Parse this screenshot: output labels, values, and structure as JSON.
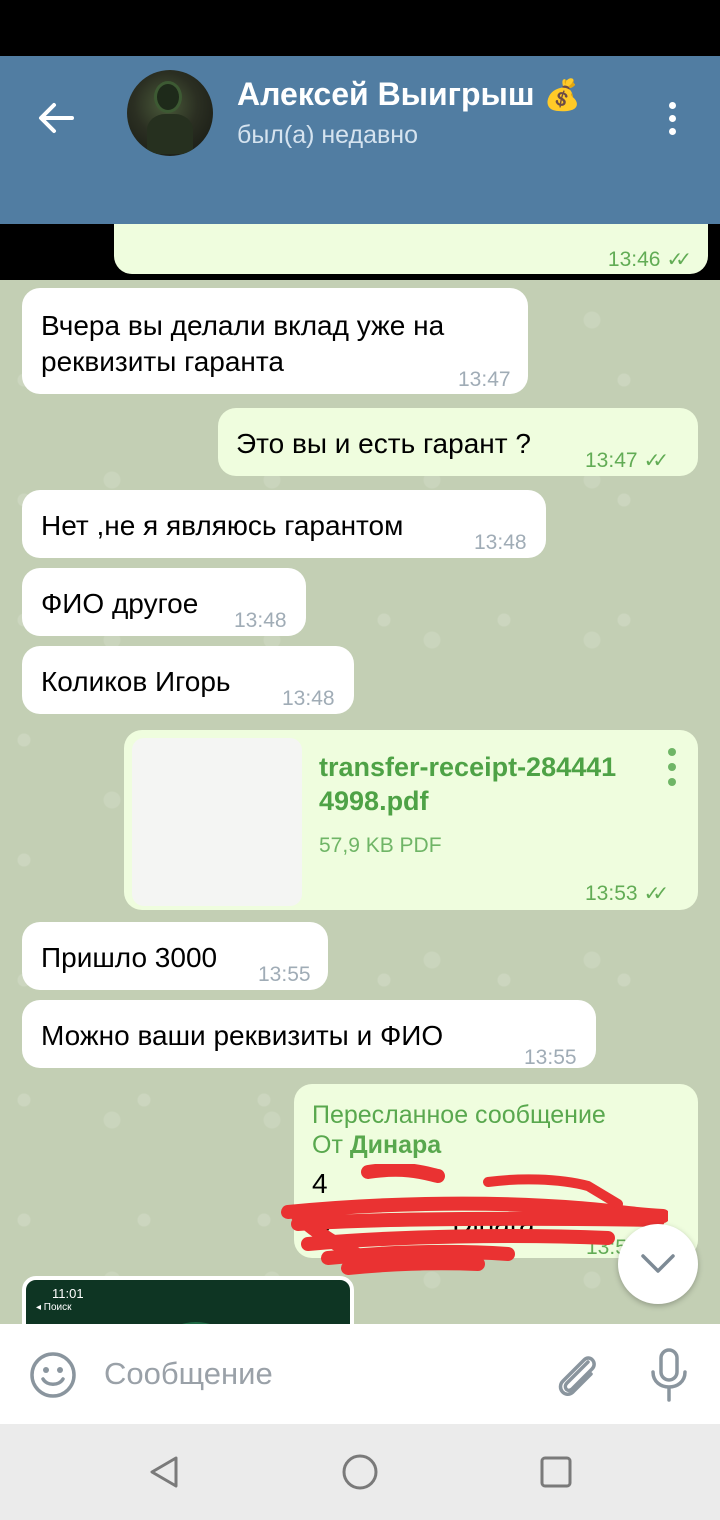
{
  "header": {
    "title": "Алексей Выигрыш",
    "title_emoji": "💰",
    "status": "был(а) недавно",
    "back_icon": "arrow-left-icon",
    "menu_icon": "more-vertical-icon"
  },
  "colors": {
    "header": "#517da2",
    "incoming_bubble": "#ffffff",
    "outgoing_bubble": "#effdde",
    "accent_green": "#4ea246"
  },
  "messages": [
    {
      "dir": "out",
      "text": "",
      "time": "13:46",
      "read": true
    },
    {
      "dir": "in",
      "text": "Вчера вы делали вклад уже на реквизиты гаранта",
      "time": "13:47"
    },
    {
      "dir": "out",
      "text": "Это вы и есть гарант ?",
      "time": "13:47",
      "read": true
    },
    {
      "dir": "in",
      "text": "Нет ,не я являюсь гарантом",
      "time": "13:48"
    },
    {
      "dir": "in",
      "text": "ФИО другое",
      "time": "13:48"
    },
    {
      "dir": "in",
      "text": "Коликов Игорь",
      "time": "13:48"
    },
    {
      "dir": "out",
      "type": "file",
      "file_name": "transfer-receipt-2844414998.pdf",
      "file_name_line1": "transfer-receipt-284441",
      "file_name_line2": "4998.pdf",
      "file_size": "57,9 KB PDF",
      "time": "13:53",
      "read": true
    },
    {
      "dir": "in",
      "text": "Пришло 3000",
      "time": "13:55"
    },
    {
      "dir": "in",
      "text": "Можно ваши реквизиты и ФИО",
      "time": "13:55"
    },
    {
      "dir": "out",
      "type": "forward",
      "forward_label": "Пересланное сообщение",
      "from_prefix": "От ",
      "from_name": "Динара",
      "line1": "4",
      "line2": "D",
      "line2_end": "Dinara",
      "time": "13:5"
    }
  ],
  "preview": {
    "time": "11:01",
    "back": "◂ Поиск"
  },
  "input": {
    "placeholder": "Сообщение",
    "emoji_icon": "smile-icon",
    "attach_icon": "paperclip-icon",
    "mic_icon": "microphone-icon"
  },
  "nav": {
    "back_icon": "triangle-back-icon",
    "home_icon": "circle-home-icon",
    "recents_icon": "square-recents-icon"
  }
}
